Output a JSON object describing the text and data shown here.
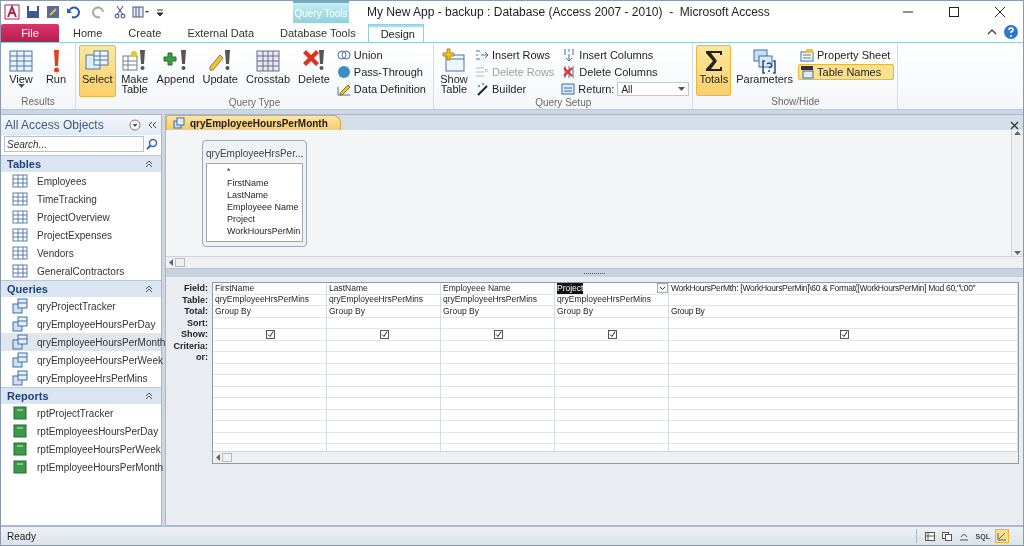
{
  "title_bar": {
    "context_label": "Query Tools",
    "title": "My New App - backup : Database (Access 2007 - 2010)  -  Microsoft Access"
  },
  "tabs": [
    {
      "label": "File",
      "kind": "file",
      "selected": false
    },
    {
      "label": "Home",
      "kind": "normal",
      "selected": false
    },
    {
      "label": "Create",
      "kind": "normal",
      "selected": false
    },
    {
      "label": "External Data",
      "kind": "normal",
      "selected": false
    },
    {
      "label": "Database Tools",
      "kind": "normal",
      "selected": false
    },
    {
      "label": "Design",
      "kind": "context",
      "selected": true
    }
  ],
  "ribbon": {
    "groups": [
      {
        "label": "Results",
        "items": [
          {
            "kind": "large",
            "label": "View",
            "dropdown": true,
            "selected": false,
            "disabled": false
          },
          {
            "kind": "large",
            "label": "Run",
            "selected": false,
            "disabled": false
          }
        ]
      },
      {
        "label": "Query Type",
        "items": [
          {
            "kind": "large",
            "label": "Select",
            "selected": true,
            "disabled": false
          },
          {
            "kind": "large",
            "label": "Make Table",
            "selected": false,
            "disabled": false
          },
          {
            "kind": "large",
            "label": "Append",
            "selected": false,
            "disabled": false
          },
          {
            "kind": "large",
            "label": "Update",
            "selected": false,
            "disabled": false
          },
          {
            "kind": "large",
            "label": "Crosstab",
            "selected": false,
            "disabled": false
          },
          {
            "kind": "large",
            "label": "Delete",
            "selected": false,
            "disabled": false
          },
          {
            "kind": "small",
            "label": "Union",
            "selected": false,
            "disabled": false
          },
          {
            "kind": "small",
            "label": "Pass-Through",
            "selected": false,
            "disabled": false
          },
          {
            "kind": "small",
            "label": "Data Definition",
            "selected": false,
            "disabled": false
          }
        ]
      },
      {
        "label": "Query Setup",
        "items": [
          {
            "kind": "large",
            "label": "Show Table",
            "selected": false,
            "disabled": false
          },
          {
            "kind": "small",
            "label": "Insert Rows",
            "selected": false,
            "disabled": false
          },
          {
            "kind": "small",
            "label": "Delete Rows",
            "selected": false,
            "disabled": true
          },
          {
            "kind": "small",
            "label": "Builder",
            "selected": false,
            "disabled": false
          },
          {
            "kind": "small",
            "label": "Insert Columns",
            "selected": false,
            "disabled": false
          },
          {
            "kind": "small",
            "label": "Delete Columns",
            "selected": false,
            "disabled": false
          },
          {
            "kind": "combo",
            "label": "Return:",
            "value": "All",
            "disabled": false
          }
        ]
      },
      {
        "label": "Show/Hide",
        "items": [
          {
            "kind": "large",
            "label": "Totals",
            "selected": true,
            "disabled": false
          },
          {
            "kind": "large",
            "label": "Parameters",
            "selected": false,
            "disabled": false
          },
          {
            "kind": "small",
            "label": "Property Sheet",
            "selected": false,
            "disabled": false
          },
          {
            "kind": "small",
            "label": "Table Names",
            "selected": true,
            "disabled": false
          }
        ]
      }
    ]
  },
  "nav": {
    "title": "All Access Objects",
    "search": {
      "placeholder": "Search..."
    },
    "sections": [
      {
        "title": "Tables",
        "kind": "table",
        "items": [
          {
            "label": "Employees",
            "selected": false
          },
          {
            "label": "TimeTracking",
            "selected": false
          },
          {
            "label": "ProjectOverview",
            "selected": false
          },
          {
            "label": "ProjectExpenses",
            "selected": false
          },
          {
            "label": "Vendors",
            "selected": false
          },
          {
            "label": "GeneralContractors",
            "selected": false
          }
        ]
      },
      {
        "title": "Queries",
        "kind": "query",
        "items": [
          {
            "label": "qryProjectTracker",
            "selected": false
          },
          {
            "label": "qryEmployeeHoursPerDay",
            "selected": false
          },
          {
            "label": "qryEmployeeHoursPerMonth",
            "selected": true
          },
          {
            "label": "qryEmployeeHoursPerWeek",
            "selected": false
          },
          {
            "label": "qryEmployeeHrsPerMins",
            "selected": false
          }
        ]
      },
      {
        "title": "Reports",
        "kind": "report",
        "items": [
          {
            "label": "rptProjectTracker",
            "selected": false
          },
          {
            "label": "rptEmployeesHoursPerDay",
            "selected": false
          },
          {
            "label": "rptEmployeeHoursPerWeek",
            "selected": false
          },
          {
            "label": "rptEmployeeHoursPerMonth",
            "selected": false
          }
        ]
      }
    ]
  },
  "document": {
    "tab": "qryEmployeeHoursPerMonth",
    "source_table": {
      "title": "qryEmployeeHrsPer...",
      "fields": [
        "*",
        "FirstName",
        "LastName",
        "Employeee Name",
        "Project",
        "WorkHoursPerMin"
      ]
    },
    "grid": {
      "row_labels": [
        "Field:",
        "Table:",
        "Total:",
        "Sort:",
        "Show:",
        "Criteria:",
        "or:"
      ],
      "columns": [
        {
          "field": "FirstName",
          "table": "qryEmployeeHrsPerMins",
          "total": "Group By",
          "show": true,
          "selected": false
        },
        {
          "field": "LastName",
          "table": "qryEmployeeHrsPerMins",
          "total": "Group By",
          "show": true,
          "selected": false
        },
        {
          "field": "Employeee Name",
          "table": "qryEmployeeHrsPerMins",
          "total": "Group By",
          "show": true,
          "selected": false
        },
        {
          "field": "Project",
          "table": "qryEmployeeHrsPerMins",
          "total": "Group By",
          "show": true,
          "selected": true
        },
        {
          "field": "WorkHoursPerMth: [WorkHoursPerMin]\\60 & Format([WorkHoursPerMin] Mod 60,\"\\:00\"",
          "total": "Group By",
          "show": true,
          "selected": false
        }
      ]
    }
  },
  "status_bar": {
    "text": "Ready",
    "views": [
      {
        "kind": "icon",
        "selected": false
      },
      {
        "kind": "icon",
        "selected": false
      },
      {
        "kind": "icon",
        "selected": false
      },
      {
        "kind": "text",
        "label": "SQL",
        "selected": false
      },
      {
        "kind": "icon",
        "selected": true
      }
    ]
  }
}
